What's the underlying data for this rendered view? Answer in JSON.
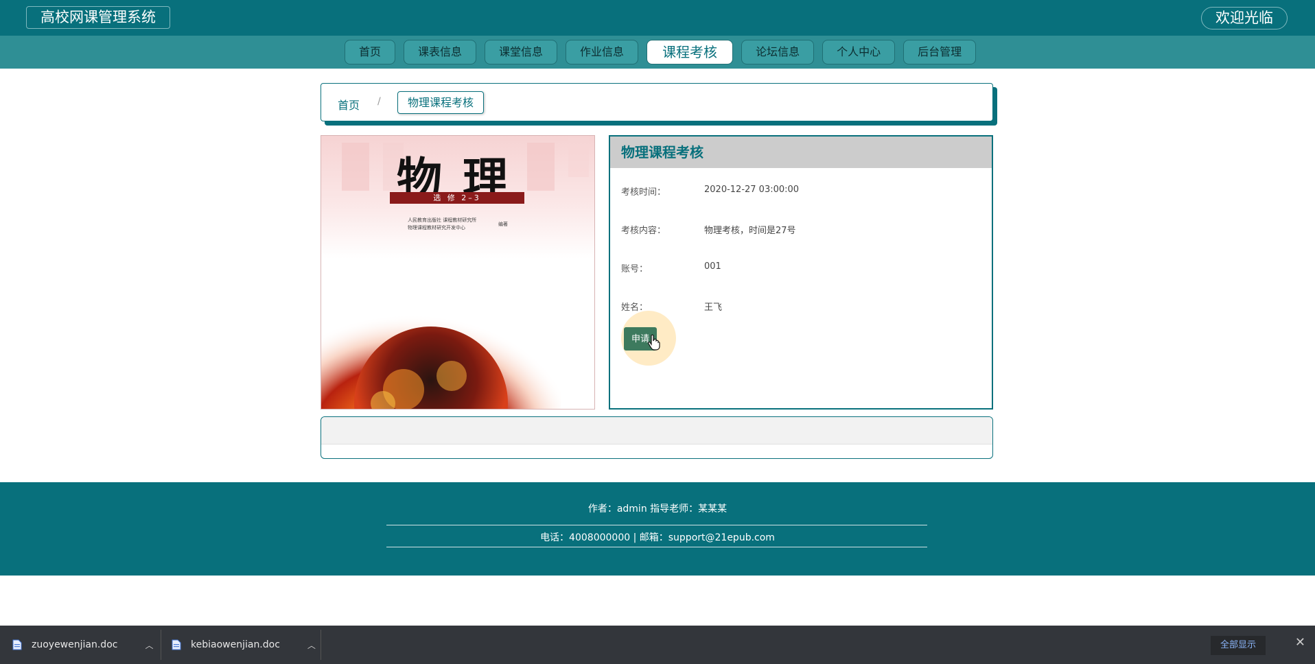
{
  "header": {
    "site_title": "高校网课管理系统",
    "welcome": "欢迎光临"
  },
  "nav": {
    "items": [
      "首页",
      "课表信息",
      "课堂信息",
      "作业信息",
      "课程考核",
      "论坛信息",
      "个人中心",
      "后台管理"
    ],
    "active": "课程考核"
  },
  "breadcrumb": {
    "home": "首页",
    "separator": "/",
    "current": "物理课程考核"
  },
  "cover": {
    "title": "物理",
    "subtitle": "选 修 2–3",
    "publisher_line1": "人民教育出版社  课程教材研究所",
    "publisher_line2": "物理课程教材研究开发中心",
    "publisher_suffix": "编著"
  },
  "detail": {
    "title": "物理课程考核",
    "fields": [
      {
        "label": "考核时间：",
        "value": "2020-12-27 03:00:00"
      },
      {
        "label": "考核内容：",
        "value": "物理考核，时间是27号"
      },
      {
        "label": "账号：",
        "value": "001"
      },
      {
        "label": "姓名：",
        "value": "王飞"
      }
    ],
    "apply_button": "申请"
  },
  "footer": {
    "line1": "作者：admin 指导老师：某某某",
    "line2": "电话：4008000000 | 邮箱：support@21epub.com"
  },
  "downloads": {
    "files": [
      "zuoyewenjian.doc",
      "kebiaowenjian.doc"
    ],
    "show_all": "全部显示",
    "close": "✕"
  },
  "colors": {
    "primary": "#08707c",
    "nav_bg": "#2f8f95",
    "apply_button": "#3d7a5e"
  }
}
